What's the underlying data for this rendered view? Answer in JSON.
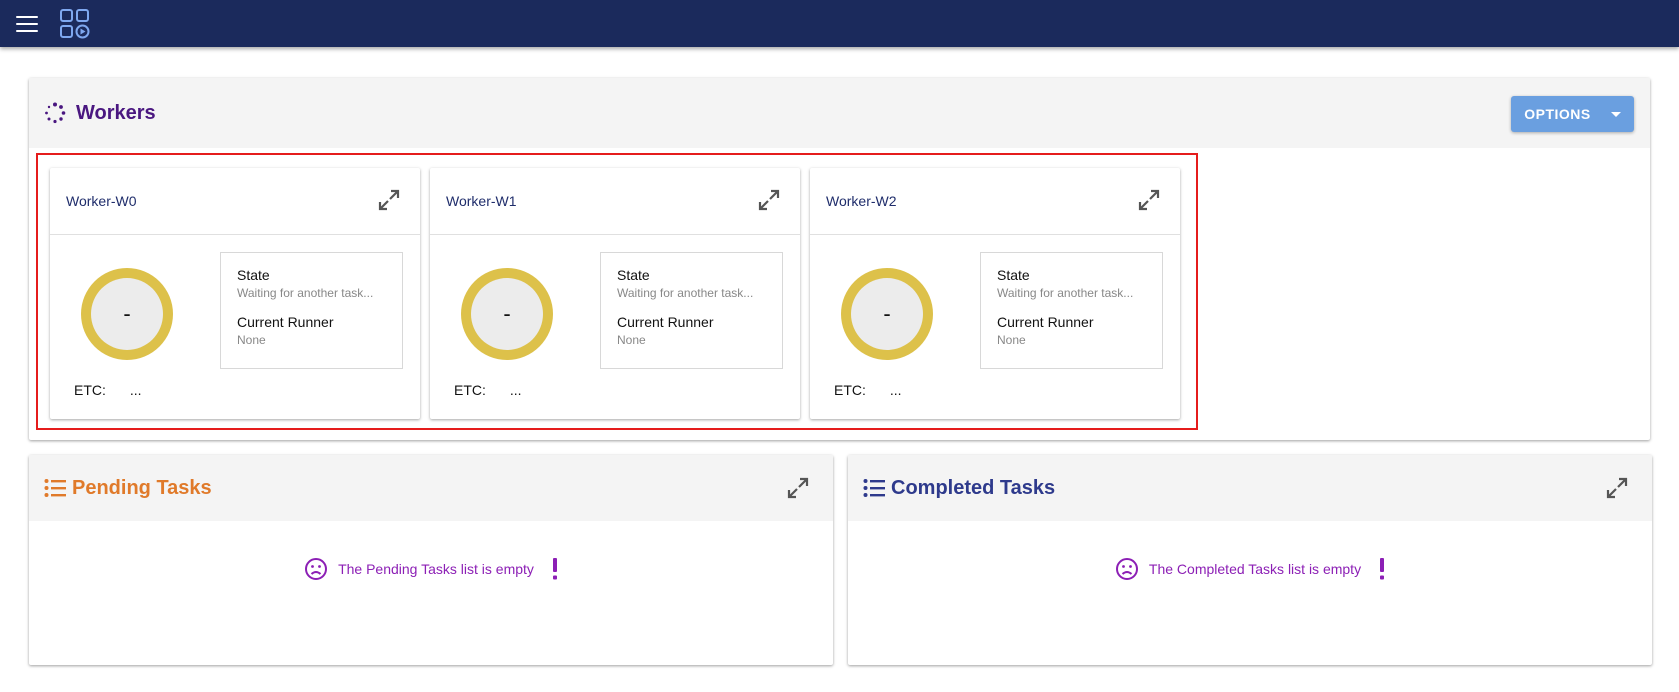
{
  "topbar": {
    "menu_icon": "hamburger-menu-icon",
    "logo_icon": "grid-play-logo-icon",
    "bg_color": "#1b2a5c"
  },
  "workers": {
    "title": "Workers",
    "title_color": "#4a1780",
    "options_label": "OPTIONS",
    "cards": [
      {
        "name": "Worker-W0",
        "gauge": "-",
        "state_label": "State",
        "state_value": "Waiting for another task...",
        "runner_label": "Current Runner",
        "runner_value": "None",
        "etc_label": "ETC:",
        "etc_value": "..."
      },
      {
        "name": "Worker-W1",
        "gauge": "-",
        "state_label": "State",
        "state_value": "Waiting for another task...",
        "runner_label": "Current Runner",
        "runner_value": "None",
        "etc_label": "ETC:",
        "etc_value": "..."
      },
      {
        "name": "Worker-W2",
        "gauge": "-",
        "state_label": "State",
        "state_value": "Waiting for another task...",
        "runner_label": "Current Runner",
        "runner_value": "None",
        "etc_label": "ETC:",
        "etc_value": "..."
      }
    ]
  },
  "pending": {
    "title": "Pending Tasks",
    "title_color": "#e07a2a",
    "empty_message": "The Pending Tasks list is empty"
  },
  "completed": {
    "title": "Completed Tasks",
    "title_color": "#2e3a8c",
    "empty_message": "The Completed Tasks list is empty"
  },
  "empty_color": "#8c1fb5",
  "gauge_color": "#ddc14a"
}
